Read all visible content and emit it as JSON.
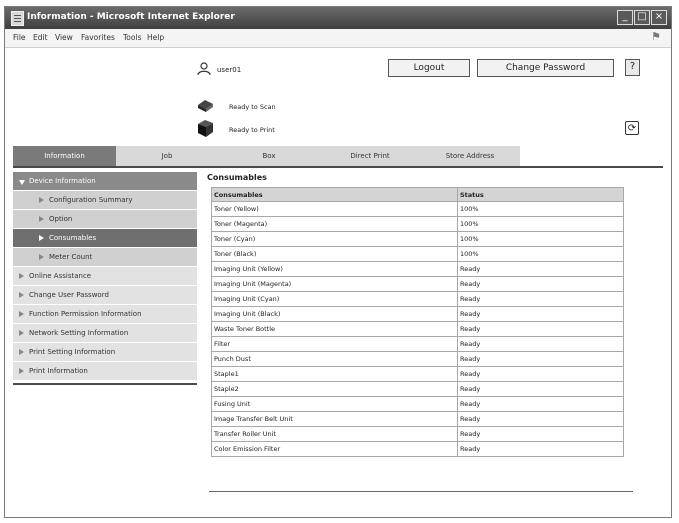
{
  "window": {
    "title": "Information - Microsoft Internet Explorer"
  },
  "menu": [
    "File",
    "Edit",
    "View",
    "Favorites",
    "Tools",
    "Help"
  ],
  "header": {
    "username": "user01",
    "logout_label": "Logout",
    "change_password_label": "Change Password",
    "scan_status": "Ready to Scan",
    "print_status": "Ready to Print"
  },
  "tabs": [
    "Information",
    "Job",
    "Box",
    "Direct Print",
    "Store Address"
  ],
  "sidebar": {
    "items": [
      {
        "label": "Device Information"
      },
      {
        "label": "Configuration Summary"
      },
      {
        "label": "Option"
      },
      {
        "label": "Consumables"
      },
      {
        "label": "Meter Count"
      },
      {
        "label": "Online Assistance"
      },
      {
        "label": "Change User Password"
      },
      {
        "label": "Function Permission Information"
      },
      {
        "label": "Network Setting Information"
      },
      {
        "label": "Print Setting Information"
      },
      {
        "label": "Print Information"
      }
    ]
  },
  "main": {
    "title": "Consumables",
    "columns": [
      "Consumables",
      "Status"
    ],
    "rows": [
      [
        "Toner (Yellow)",
        "100%"
      ],
      [
        "Toner (Magenta)",
        "100%"
      ],
      [
        "Toner (Cyan)",
        "100%"
      ],
      [
        "Toner (Black)",
        "100%"
      ],
      [
        "Imaging Unit (Yellow)",
        "Ready"
      ],
      [
        "Imaging Unit (Magenta)",
        "Ready"
      ],
      [
        "Imaging Unit (Cyan)",
        "Ready"
      ],
      [
        "Imaging Unit (Black)",
        "Ready"
      ],
      [
        "Waste Toner Bottle",
        "Ready"
      ],
      [
        "Filter",
        "Ready"
      ],
      [
        "Punch Dust",
        "Ready"
      ],
      [
        "Staple1",
        "Ready"
      ],
      [
        "Staple2",
        "Ready"
      ],
      [
        "Fusing Unit",
        "Ready"
      ],
      [
        "Image Transfer Belt Unit",
        "Ready"
      ],
      [
        "Transfer Roller Unit",
        "Ready"
      ],
      [
        "Color Emission Filter",
        "Ready"
      ]
    ]
  },
  "icons": {
    "app": "ie-page-icon",
    "user": "user-icon",
    "help": "help-icon",
    "scan": "scanner-icon",
    "print": "printer-icon",
    "refresh": "refresh-icon",
    "windows_logo": "windows-flag-icon"
  },
  "colors": {
    "title_bar": "#4a4a4a",
    "active_tab": "#7a7a7a",
    "sidebar_head": "#8a8a8a",
    "sidebar_selected": "#6f6f6f"
  }
}
